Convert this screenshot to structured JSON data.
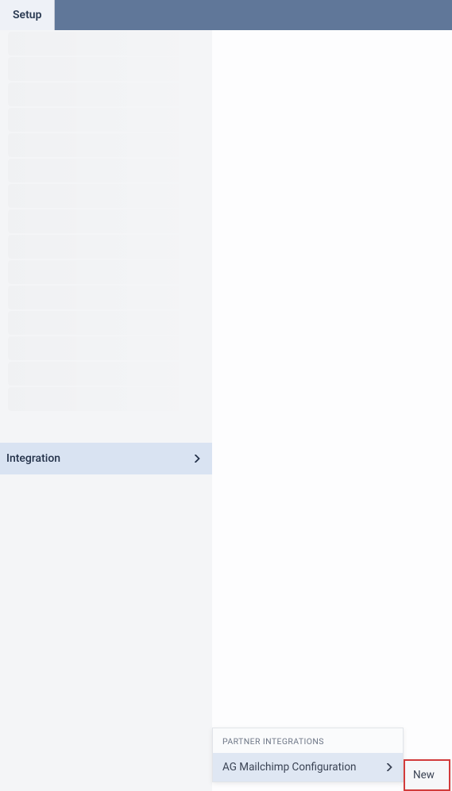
{
  "header": {
    "tab_label": "Setup"
  },
  "sidebar": {
    "items": [
      {
        "label": "Integration",
        "active": true
      }
    ]
  },
  "flyout": {
    "section_title": "PARTNER INTEGRATIONS",
    "items": [
      {
        "label": "AG Mailchimp Configuration"
      }
    ]
  },
  "flyout2": {
    "items": [
      {
        "label": "New"
      }
    ]
  }
}
